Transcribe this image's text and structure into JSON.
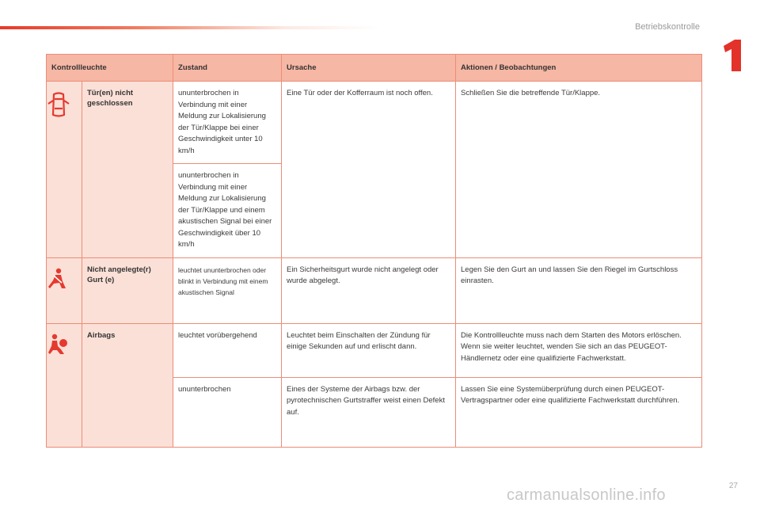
{
  "header": {
    "section_title": "Betriebskontrolle",
    "chapter_number": "1"
  },
  "table": {
    "headers": {
      "kontrollleuchte": "Kontrollleuchte",
      "zustand": "Zustand",
      "ursache": "Ursache",
      "aktionen": "Aktionen / Beobachtungen"
    },
    "rows": [
      {
        "icon": "door-open-warning-icon",
        "name": "Tür(en) nicht geschlossen",
        "zustand_1": "ununterbrochen in Verbindung mit einer Meldung zur Lokalisierung der Tür/Klappe bei einer Geschwindigkeit unter 10 km/h",
        "zustand_2": "ununterbrochen in Verbindung mit einer Meldung zur Lokalisierung der Tür/Klappe und einem akustischen Signal bei einer Geschwindigkeit über 10 km/h",
        "ursache": "Eine Tür oder der Kofferraum ist noch offen.",
        "aktion": "Schließen Sie die betreffende Tür/Klappe."
      },
      {
        "icon": "seatbelt-warning-icon",
        "name": "Nicht angelegte(r) Gurt (e)",
        "zustand": "leuchtet ununterbrochen oder blinkt in Verbindung mit einem akustischen Signal",
        "ursache": "Ein Sicherheitsgurt wurde nicht angelegt oder wurde abgelegt.",
        "aktion": "Legen Sie den Gurt an und lassen Sie den Riegel im Gurtschloss einrasten."
      },
      {
        "icon": "airbag-warning-icon",
        "name": "Airbags",
        "zustand_1": "leuchtet vorübergehend",
        "ursache_1": "Leuchtet beim Einschalten der Zündung für einige Sekunden auf und erlischt dann.",
        "aktion_1a": "Die Kontrollleuchte muss nach dem Starten des Motors erlöschen.",
        "aktion_1b": "Wenn sie weiter leuchtet, wenden Sie sich an das PEUGEOT-Händlernetz oder eine qualifizierte Fachwerkstatt.",
        "zustand_2": "ununterbrochen",
        "ursache_2": "Eines der Systeme der Airbags bzw. der pyrotechnischen Gurtstraffer weist einen Defekt auf.",
        "aktion_2": "Lassen Sie eine Systemüberprüfung durch einen PEUGEOT-Vertragspartner oder eine qualifizierte Fachwerkstatt durchführen."
      }
    ]
  },
  "footer": {
    "page_number": "27",
    "watermark": "carmanualsonline.info"
  },
  "colors": {
    "header_fill": "#f6b7a4",
    "side_fill": "#fbe0d7",
    "border": "#ec8d78",
    "icon_red": "#e53a2f",
    "accent_red": "#e8392a"
  }
}
